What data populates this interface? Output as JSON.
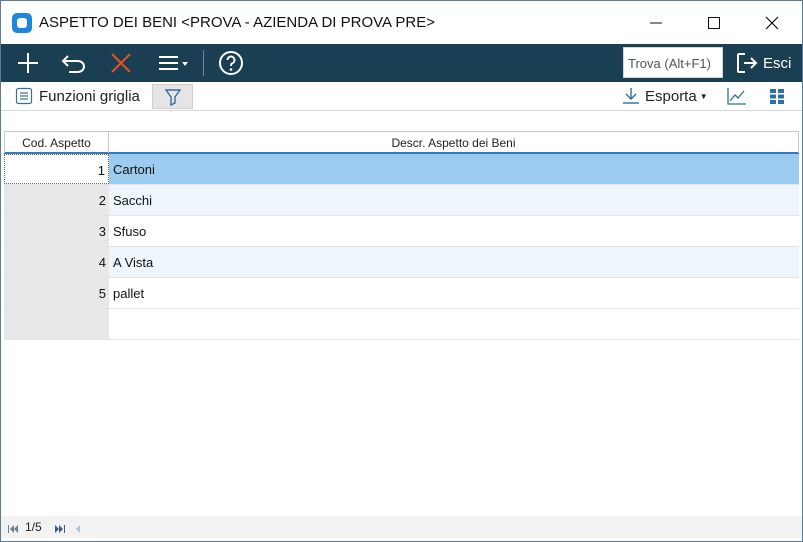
{
  "window": {
    "title": "ASPETTO DEI BENI <PROVA - AZIENDA DI PROVA PRE>"
  },
  "toolbar": {
    "search_placeholder": "Trova (Alt+F1)",
    "exit_label": "Esci"
  },
  "subbar": {
    "grid_functions_label": "Funzioni griglia",
    "export_label": "Esporta"
  },
  "grid": {
    "columns": [
      "Cod. Aspetto",
      "Descr. Aspetto dei Beni"
    ],
    "rows": [
      {
        "code": "1",
        "description": "Cartoni"
      },
      {
        "code": "2",
        "description": "Sacchi"
      },
      {
        "code": "3",
        "description": "Sfuso"
      },
      {
        "code": "4",
        "description": "A Vista"
      },
      {
        "code": "5",
        "description": "pallet"
      }
    ]
  },
  "pager": {
    "text": "1/5"
  },
  "colors": {
    "toolbar_bg": "#1a3e52",
    "selected_row": "#9ccbf0",
    "alt_row": "#eef6fc",
    "accent": "#1e88d8",
    "cancel_icon": "#e8541e"
  }
}
